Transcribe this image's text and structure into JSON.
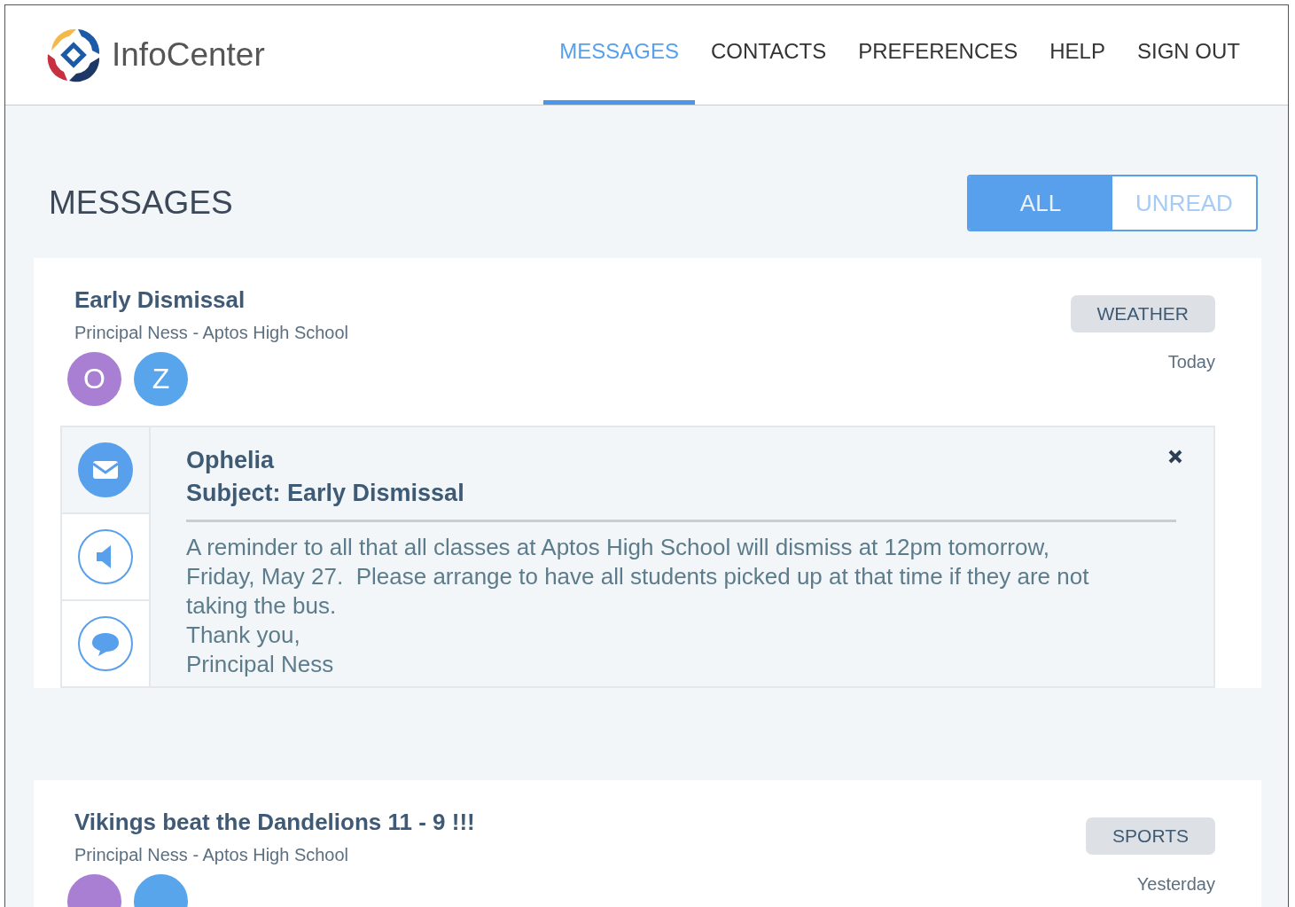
{
  "app": {
    "name": "InfoCenter"
  },
  "nav": [
    {
      "label": "MESSAGES",
      "selected": true
    },
    {
      "label": "CONTACTS",
      "selected": false
    },
    {
      "label": "PREFERENCES",
      "selected": false
    },
    {
      "label": "HELP",
      "selected": false
    },
    {
      "label": "SIGN OUT",
      "selected": false
    }
  ],
  "page_title": "MESSAGES",
  "filter": [
    {
      "label": "ALL",
      "selected": true
    },
    {
      "label": "UNREAD",
      "selected": false
    }
  ],
  "messages": [
    {
      "title": "Early Dismissal",
      "sender": "Principal Ness - Aptos High School",
      "tag": "WEATHER",
      "date": "Today",
      "avatars": [
        {
          "letter": "O",
          "color": "#a97fd3"
        },
        {
          "letter": "Z",
          "color": "#58a5ec"
        }
      ],
      "detail": {
        "recipient": "Ophelia",
        "subject": "Subject: Early Dismissal",
        "channels": [
          {
            "kind": "email",
            "selected": true
          },
          {
            "kind": "voice",
            "selected": false
          },
          {
            "kind": "sms",
            "selected": false
          }
        ],
        "body": [
          "A reminder to all that all classes at Aptos High School will dismiss at 12pm tomorrow,",
          "Friday, May 27.  Please arrange to have all students picked up at that time if they are not",
          "taking the bus.",
          "Thank you,",
          "Principal Ness"
        ]
      }
    },
    {
      "title": "Vikings beat the Dandelions 11 - 9 !!!",
      "sender": "Principal Ness - Aptos High School",
      "tag": "SPORTS",
      "date": "Yesterday",
      "avatars": [
        {
          "color": "#a97fd3"
        },
        {
          "color": "#58a5ec"
        }
      ]
    }
  ]
}
